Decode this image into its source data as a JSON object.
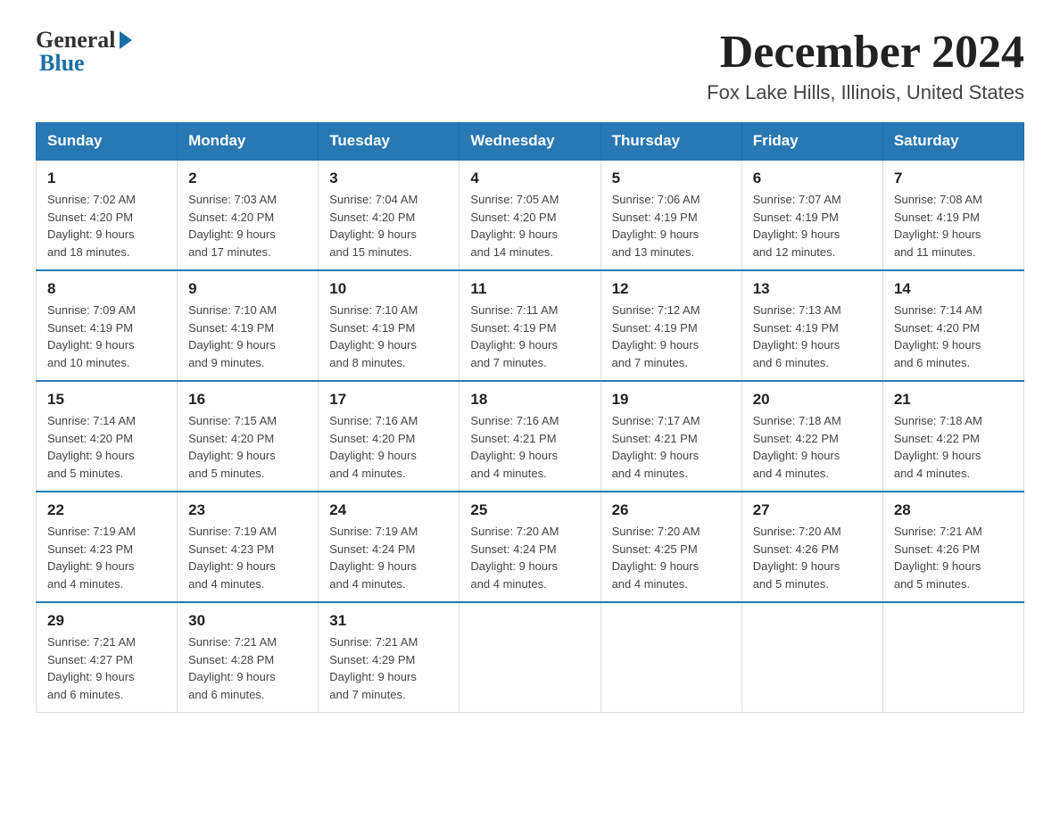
{
  "logo": {
    "general": "General",
    "blue": "Blue"
  },
  "title": "December 2024",
  "location": "Fox Lake Hills, Illinois, United States",
  "days_of_week": [
    "Sunday",
    "Monday",
    "Tuesday",
    "Wednesday",
    "Thursday",
    "Friday",
    "Saturday"
  ],
  "weeks": [
    [
      {
        "day": "1",
        "sunrise": "7:02 AM",
        "sunset": "4:20 PM",
        "daylight": "9 hours and 18 minutes."
      },
      {
        "day": "2",
        "sunrise": "7:03 AM",
        "sunset": "4:20 PM",
        "daylight": "9 hours and 17 minutes."
      },
      {
        "day": "3",
        "sunrise": "7:04 AM",
        "sunset": "4:20 PM",
        "daylight": "9 hours and 15 minutes."
      },
      {
        "day": "4",
        "sunrise": "7:05 AM",
        "sunset": "4:20 PM",
        "daylight": "9 hours and 14 minutes."
      },
      {
        "day": "5",
        "sunrise": "7:06 AM",
        "sunset": "4:19 PM",
        "daylight": "9 hours and 13 minutes."
      },
      {
        "day": "6",
        "sunrise": "7:07 AM",
        "sunset": "4:19 PM",
        "daylight": "9 hours and 12 minutes."
      },
      {
        "day": "7",
        "sunrise": "7:08 AM",
        "sunset": "4:19 PM",
        "daylight": "9 hours and 11 minutes."
      }
    ],
    [
      {
        "day": "8",
        "sunrise": "7:09 AM",
        "sunset": "4:19 PM",
        "daylight": "9 hours and 10 minutes."
      },
      {
        "day": "9",
        "sunrise": "7:10 AM",
        "sunset": "4:19 PM",
        "daylight": "9 hours and 9 minutes."
      },
      {
        "day": "10",
        "sunrise": "7:10 AM",
        "sunset": "4:19 PM",
        "daylight": "9 hours and 8 minutes."
      },
      {
        "day": "11",
        "sunrise": "7:11 AM",
        "sunset": "4:19 PM",
        "daylight": "9 hours and 7 minutes."
      },
      {
        "day": "12",
        "sunrise": "7:12 AM",
        "sunset": "4:19 PM",
        "daylight": "9 hours and 7 minutes."
      },
      {
        "day": "13",
        "sunrise": "7:13 AM",
        "sunset": "4:19 PM",
        "daylight": "9 hours and 6 minutes."
      },
      {
        "day": "14",
        "sunrise": "7:14 AM",
        "sunset": "4:20 PM",
        "daylight": "9 hours and 6 minutes."
      }
    ],
    [
      {
        "day": "15",
        "sunrise": "7:14 AM",
        "sunset": "4:20 PM",
        "daylight": "9 hours and 5 minutes."
      },
      {
        "day": "16",
        "sunrise": "7:15 AM",
        "sunset": "4:20 PM",
        "daylight": "9 hours and 5 minutes."
      },
      {
        "day": "17",
        "sunrise": "7:16 AM",
        "sunset": "4:20 PM",
        "daylight": "9 hours and 4 minutes."
      },
      {
        "day": "18",
        "sunrise": "7:16 AM",
        "sunset": "4:21 PM",
        "daylight": "9 hours and 4 minutes."
      },
      {
        "day": "19",
        "sunrise": "7:17 AM",
        "sunset": "4:21 PM",
        "daylight": "9 hours and 4 minutes."
      },
      {
        "day": "20",
        "sunrise": "7:18 AM",
        "sunset": "4:22 PM",
        "daylight": "9 hours and 4 minutes."
      },
      {
        "day": "21",
        "sunrise": "7:18 AM",
        "sunset": "4:22 PM",
        "daylight": "9 hours and 4 minutes."
      }
    ],
    [
      {
        "day": "22",
        "sunrise": "7:19 AM",
        "sunset": "4:23 PM",
        "daylight": "9 hours and 4 minutes."
      },
      {
        "day": "23",
        "sunrise": "7:19 AM",
        "sunset": "4:23 PM",
        "daylight": "9 hours and 4 minutes."
      },
      {
        "day": "24",
        "sunrise": "7:19 AM",
        "sunset": "4:24 PM",
        "daylight": "9 hours and 4 minutes."
      },
      {
        "day": "25",
        "sunrise": "7:20 AM",
        "sunset": "4:24 PM",
        "daylight": "9 hours and 4 minutes."
      },
      {
        "day": "26",
        "sunrise": "7:20 AM",
        "sunset": "4:25 PM",
        "daylight": "9 hours and 4 minutes."
      },
      {
        "day": "27",
        "sunrise": "7:20 AM",
        "sunset": "4:26 PM",
        "daylight": "9 hours and 5 minutes."
      },
      {
        "day": "28",
        "sunrise": "7:21 AM",
        "sunset": "4:26 PM",
        "daylight": "9 hours and 5 minutes."
      }
    ],
    [
      {
        "day": "29",
        "sunrise": "7:21 AM",
        "sunset": "4:27 PM",
        "daylight": "9 hours and 6 minutes."
      },
      {
        "day": "30",
        "sunrise": "7:21 AM",
        "sunset": "4:28 PM",
        "daylight": "9 hours and 6 minutes."
      },
      {
        "day": "31",
        "sunrise": "7:21 AM",
        "sunset": "4:29 PM",
        "daylight": "9 hours and 7 minutes."
      },
      null,
      null,
      null,
      null
    ]
  ],
  "labels": {
    "sunrise": "Sunrise:",
    "sunset": "Sunset:",
    "daylight": "Daylight:"
  }
}
